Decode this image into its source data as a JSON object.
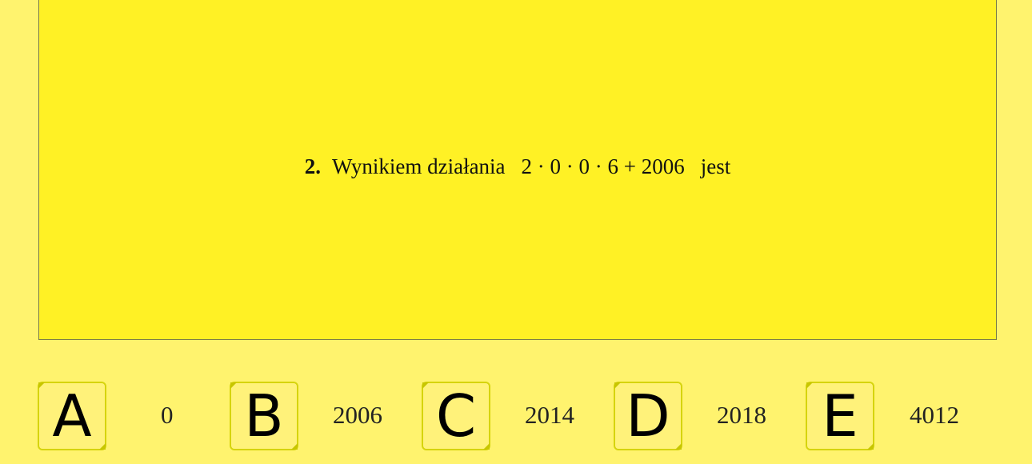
{
  "question": {
    "number": "2.",
    "lead": "Wynikiem działania",
    "expression": "2 · 0 · 0 · 6 + 2006",
    "tail": "jest"
  },
  "answers": [
    {
      "letter": "A",
      "value": "0"
    },
    {
      "letter": "B",
      "value": "2006"
    },
    {
      "letter": "C",
      "value": "2014"
    },
    {
      "letter": "D",
      "value": "2018"
    },
    {
      "letter": "E",
      "value": "4012"
    }
  ],
  "colors": {
    "page_background": "#fff36e",
    "question_panel": "#fff125",
    "key_border": "#d6d40d"
  }
}
